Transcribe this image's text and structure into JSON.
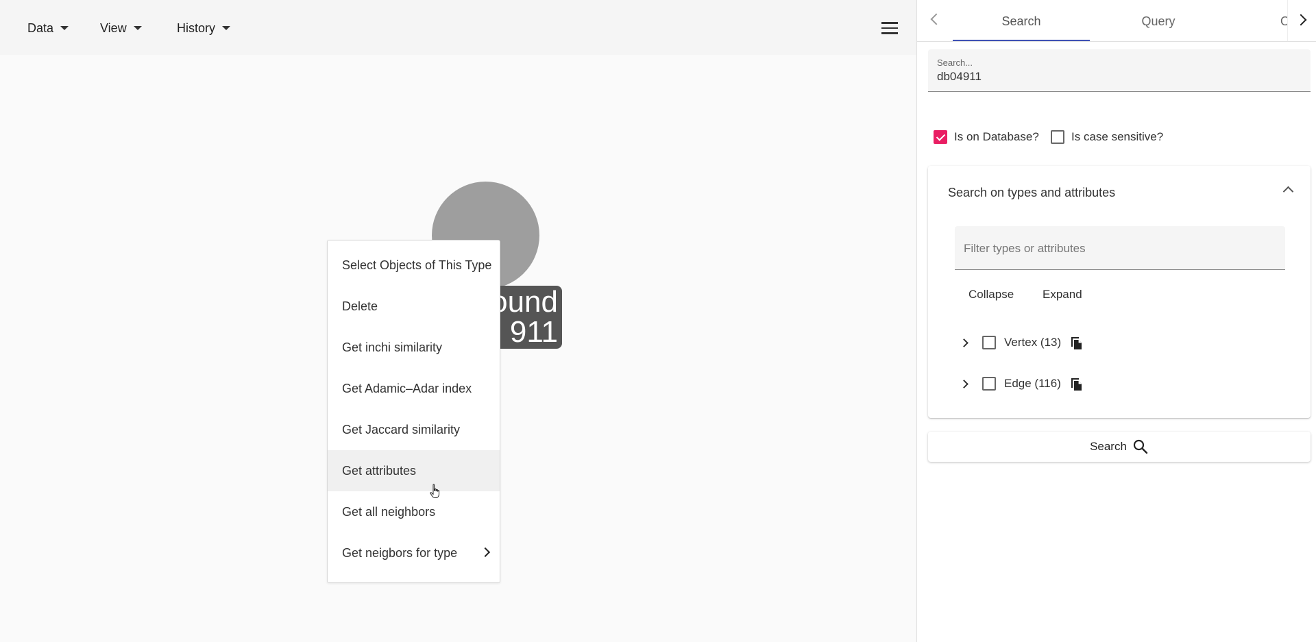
{
  "toolbar": {
    "menus": [
      {
        "label": "Data"
      },
      {
        "label": "View"
      },
      {
        "label": "History"
      }
    ],
    "hamburger_icon": "menu-icon"
  },
  "graph": {
    "node_label": "ound\n911",
    "node_color": "#9e9e9e"
  },
  "context_menu": {
    "items": [
      {
        "label": "Select Objects of This Type"
      },
      {
        "label": "Delete"
      },
      {
        "label": "Get inchi similarity"
      },
      {
        "label": "Get Adamic–Adar index"
      },
      {
        "label": "Get Jaccard similarity"
      },
      {
        "label": "Get attributes"
      },
      {
        "label": "Get all neighbors"
      },
      {
        "label": "Get neigbors for type"
      }
    ],
    "hovered_item": "Get attributes"
  },
  "panel": {
    "tabs": [
      {
        "label": "Search",
        "active": true
      },
      {
        "label": "Query"
      },
      {
        "label": "O"
      }
    ],
    "search": {
      "label": "Search...",
      "value": "db04911"
    },
    "options": {
      "on_database_label": "Is on Database?",
      "on_database_checked": true,
      "case_sensitive_label": "Is case sensitive?",
      "case_sensitive_checked": false
    },
    "types_section": {
      "title": "Search on types and attributes",
      "filter_placeholder": "Filter types or attributes",
      "collapse_label": "Collapse",
      "expand_label": "Expand",
      "tree": [
        {
          "label": "Vertex (13)"
        },
        {
          "label": "Edge (116)"
        }
      ]
    },
    "search_button_label": "Search"
  },
  "colors": {
    "accent": "#e91e63",
    "tab_indicator": "#3f51b5"
  }
}
